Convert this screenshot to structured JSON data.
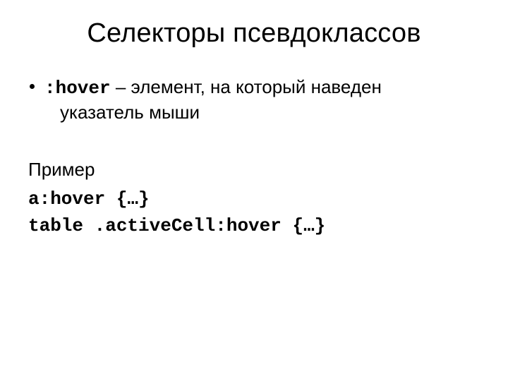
{
  "title": "Селекторы псевдоклассов",
  "bullet": {
    "code": ":hover",
    "desc_line1": " – элемент, на который наведен",
    "desc_line2": "указатель мыши"
  },
  "example_label": "Пример",
  "code_lines": [
    "a:hover {…}",
    "table .activeCell:hover {…}"
  ]
}
